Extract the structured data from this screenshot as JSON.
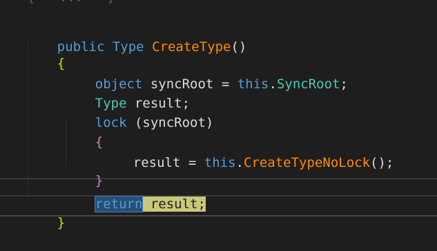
{
  "editor": {
    "top_cut_text": "[   ...   ]",
    "lines": [
      {
        "t0": "public",
        "t1": "Type",
        "t2": "CreateType",
        "t3": "()"
      },
      {
        "brace": "{"
      },
      {
        "t0": "object",
        "t1": "syncRoot",
        "t2": "=",
        "t3": "this",
        "t4": ".",
        "t5": "SyncRoot",
        "t6": ";"
      },
      {
        "t0": "Type",
        "t1": "result",
        "t2": ";"
      },
      {
        "t0": "lock",
        "t1": "(syncRoot)"
      },
      {
        "brace": "{"
      },
      {
        "t0": "result",
        "t1": "=",
        "t2": "this",
        "t3": ".",
        "t4": "CreateTypeNoLock",
        "t5": "();"
      },
      {
        "brace": "}"
      },
      {
        "t0": "return",
        "t1": "result",
        "t2": ";"
      },
      {
        "brace": "}"
      }
    ]
  },
  "colors": {
    "background": "#1e1e1e",
    "keyword": "#569cd6",
    "type": "#4ec9b0",
    "method": "#ff8c00",
    "identifier": "#dcdcdc",
    "selection_keyword": "#264f78",
    "selection_identifier": "#c8c87a"
  }
}
